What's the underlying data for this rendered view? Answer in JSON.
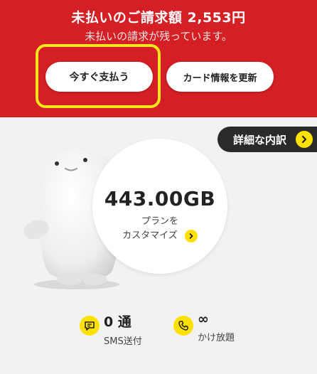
{
  "banner": {
    "title": "未払いのご請求額 2,553円",
    "subtitle": "未払いの請求が残っています。",
    "pay_button": "今すぐ支払う",
    "card_button": "カード情報を更新"
  },
  "detail_button": "詳細な内訳",
  "data": {
    "amount": "443.00GB",
    "plan_line1": "プランを",
    "plan_line2": "カスタマイズ"
  },
  "stats": {
    "sms_value": "0 通",
    "sms_label": "SMS送付",
    "call_value": "∞",
    "call_label": "かけ放題"
  },
  "colors": {
    "banner_red": "#d41f24",
    "accent_yellow": "#ffe100",
    "highlight_yellow": "#f6e51d",
    "dark_pill": "#2a2a2a"
  }
}
